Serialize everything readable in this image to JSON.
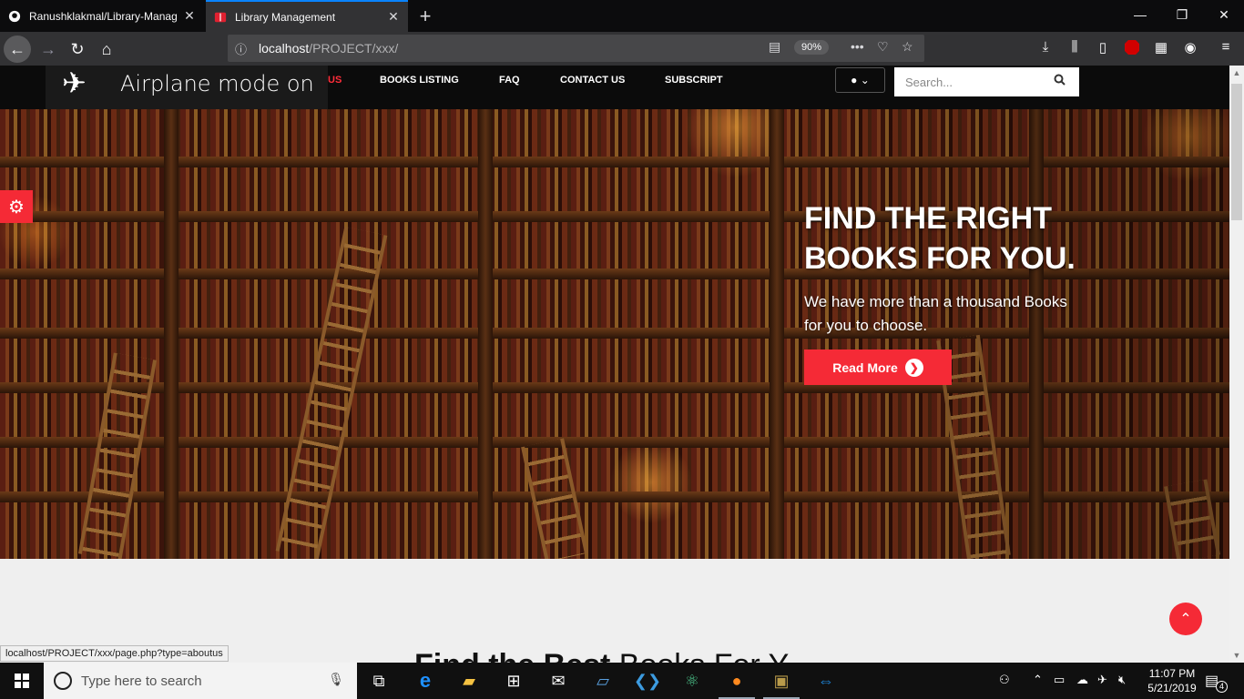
{
  "browser": {
    "tabs": [
      {
        "title": "Ranushklakmal/Library-Manag",
        "icon": "github-icon",
        "active": false
      },
      {
        "title": "Library Management",
        "icon": "book-icon",
        "active": true
      }
    ],
    "new_tab": "+",
    "url_host": "localhost",
    "url_path": "/PROJECT/xxx/",
    "zoom": "90%",
    "status_url": "localhost/PROJECT/xxx/page.php?type=aboutus"
  },
  "overlay": {
    "airplane_label": "Airplane mode on"
  },
  "site": {
    "menu": [
      {
        "label": "US",
        "active": true
      },
      {
        "label": "BOOKS LISTING"
      },
      {
        "label": "FAQ"
      },
      {
        "label": "CONTACT US"
      },
      {
        "label": "SUBSCRIPT"
      }
    ],
    "search_placeholder": "Search...",
    "hero": {
      "title": "FIND THE RIGHT BOOKS FOR YOU.",
      "subtitle": "We have more than a thousand Books for you to choose.",
      "button": "Read More"
    },
    "section_heading_bold": "Find the Best",
    "section_heading_light": " Books For Y..."
  },
  "colors": {
    "accent": "#f52a36",
    "header_bg": "#0b0b0b",
    "browser_tab_active_bar": "#0a84ff"
  },
  "taskbar": {
    "search_placeholder": "Type here to search",
    "time": "11:07 PM",
    "date": "5/21/2019",
    "notifications": "4"
  }
}
